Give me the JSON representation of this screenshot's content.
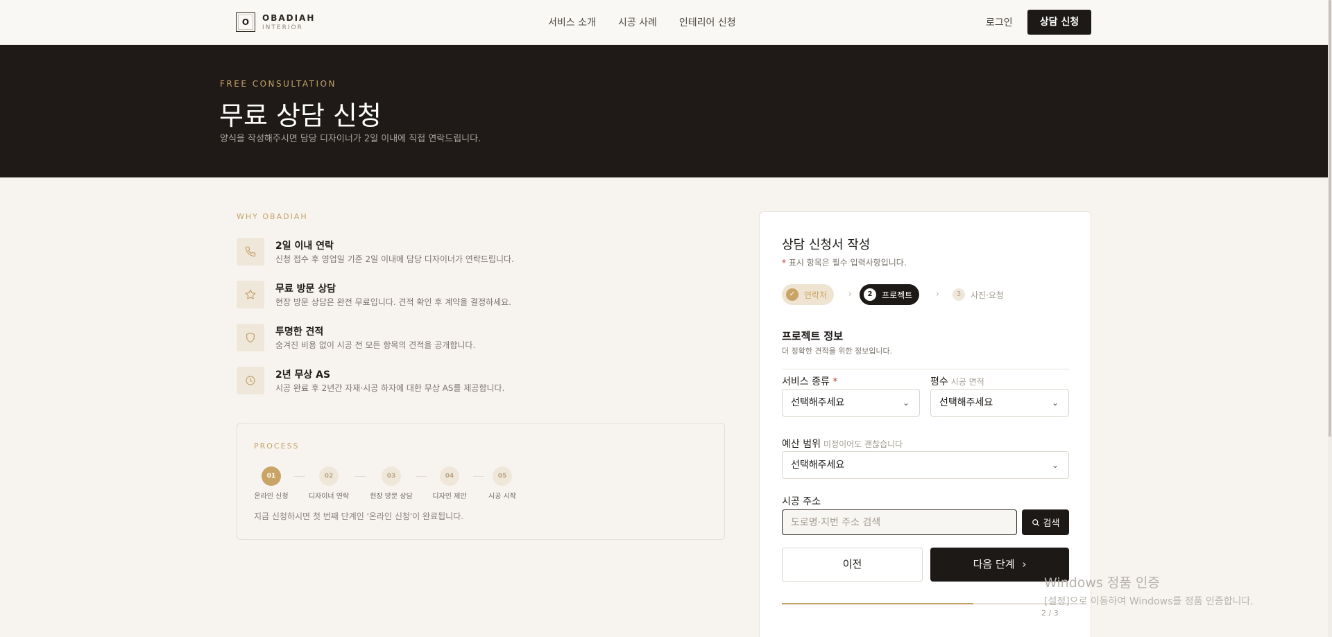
{
  "header": {
    "logo_letter": "O",
    "logo_name": "OBADIAH",
    "logo_sub": "INTERIOR",
    "nav": [
      "서비스 소개",
      "시공 사례",
      "인테리어 신청"
    ],
    "login": "로그인",
    "cta": "상담 신청"
  },
  "hero": {
    "kicker": "FREE CONSULTATION",
    "title": "무료 상담 신청",
    "subtitle": "양식을 작성해주시면 담당 디자이너가 2일 이내에 직접 연락드립니다."
  },
  "why": {
    "label": "WHY OBADIAH",
    "items": [
      {
        "icon": "phone-icon",
        "title": "2일 이내 연락",
        "desc": "신청 접수 후 영업일 기준 2일 이내에 담당 디자이너가 연락드립니다."
      },
      {
        "icon": "star-icon",
        "title": "무료 방문 상담",
        "desc": "현장 방문 상담은 완전 무료입니다. 견적 확인 후 계약을 결정하세요."
      },
      {
        "icon": "shield-icon",
        "title": "투명한 견적",
        "desc": "숨겨진 비용 없이 시공 전 모든 항목의 견적을 공개합니다."
      },
      {
        "icon": "clock-icon",
        "title": "2년 무상 AS",
        "desc": "시공 완료 후 2년간 자재·시공 하자에 대한 무상 AS를 제공합니다."
      }
    ]
  },
  "process": {
    "label": "PROCESS",
    "steps": [
      {
        "num": "01",
        "label": "온라인 신청"
      },
      {
        "num": "02",
        "label": "디자이너 연락"
      },
      {
        "num": "03",
        "label": "현장 방문 상담"
      },
      {
        "num": "04",
        "label": "디자인 제안"
      },
      {
        "num": "05",
        "label": "시공 시작"
      }
    ],
    "active_index": 0,
    "note": "지금 신청하시면 첫 번째 단계인 '온라인 신청'이 완료됩니다."
  },
  "form": {
    "title": "상담 신청서 작성",
    "required_mark": "*",
    "required_note": " 표시 항목은 필수 입력사항입니다.",
    "steps": [
      {
        "num": "✓",
        "label": "연락처",
        "state": "done"
      },
      {
        "num": "2",
        "label": "프로젝트",
        "state": "current"
      },
      {
        "num": "3",
        "label": "사진·요청",
        "state": "todo"
      }
    ],
    "section_title": "프로젝트 정보",
    "section_sub": "더 정확한 견적을 위한 정보입니다.",
    "service_label": "서비스 종류",
    "service_value": "선택해주세요",
    "area_label": "평수",
    "area_hint": "시공 면적",
    "area_value": "선택해주세요",
    "budget_label": "예산 범위",
    "budget_hint": "미정이어도 괜찮습니다",
    "budget_value": "선택해주세요",
    "address_label": "시공 주소",
    "address_placeholder": "도로명·지번 주소 검색",
    "address_value": "",
    "search_label": "검색",
    "prev_label": "이전",
    "next_label": "다음 단계",
    "progress_text": "2 / 3",
    "progress_fraction": 0.667
  },
  "watermark": {
    "title": "Windows 정품 인증",
    "sub": "[설정]으로 이동하여 Windows를 정품 인증합니다."
  },
  "colors": {
    "accent": "#c3a26a",
    "dark": "#1c1916",
    "background": "#f7f4ef"
  }
}
